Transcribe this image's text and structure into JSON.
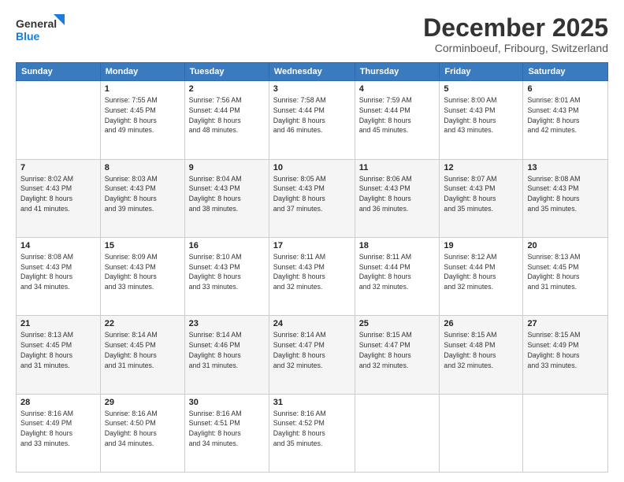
{
  "header": {
    "logo_line1": "General",
    "logo_line2": "Blue",
    "month": "December 2025",
    "location": "Corminboeuf, Fribourg, Switzerland"
  },
  "weekdays": [
    "Sunday",
    "Monday",
    "Tuesday",
    "Wednesday",
    "Thursday",
    "Friday",
    "Saturday"
  ],
  "weeks": [
    [
      {
        "day": "",
        "info": ""
      },
      {
        "day": "1",
        "info": "Sunrise: 7:55 AM\nSunset: 4:45 PM\nDaylight: 8 hours\nand 49 minutes."
      },
      {
        "day": "2",
        "info": "Sunrise: 7:56 AM\nSunset: 4:44 PM\nDaylight: 8 hours\nand 48 minutes."
      },
      {
        "day": "3",
        "info": "Sunrise: 7:58 AM\nSunset: 4:44 PM\nDaylight: 8 hours\nand 46 minutes."
      },
      {
        "day": "4",
        "info": "Sunrise: 7:59 AM\nSunset: 4:44 PM\nDaylight: 8 hours\nand 45 minutes."
      },
      {
        "day": "5",
        "info": "Sunrise: 8:00 AM\nSunset: 4:43 PM\nDaylight: 8 hours\nand 43 minutes."
      },
      {
        "day": "6",
        "info": "Sunrise: 8:01 AM\nSunset: 4:43 PM\nDaylight: 8 hours\nand 42 minutes."
      }
    ],
    [
      {
        "day": "7",
        "info": "Sunrise: 8:02 AM\nSunset: 4:43 PM\nDaylight: 8 hours\nand 41 minutes."
      },
      {
        "day": "8",
        "info": "Sunrise: 8:03 AM\nSunset: 4:43 PM\nDaylight: 8 hours\nand 39 minutes."
      },
      {
        "day": "9",
        "info": "Sunrise: 8:04 AM\nSunset: 4:43 PM\nDaylight: 8 hours\nand 38 minutes."
      },
      {
        "day": "10",
        "info": "Sunrise: 8:05 AM\nSunset: 4:43 PM\nDaylight: 8 hours\nand 37 minutes."
      },
      {
        "day": "11",
        "info": "Sunrise: 8:06 AM\nSunset: 4:43 PM\nDaylight: 8 hours\nand 36 minutes."
      },
      {
        "day": "12",
        "info": "Sunrise: 8:07 AM\nSunset: 4:43 PM\nDaylight: 8 hours\nand 35 minutes."
      },
      {
        "day": "13",
        "info": "Sunrise: 8:08 AM\nSunset: 4:43 PM\nDaylight: 8 hours\nand 35 minutes."
      }
    ],
    [
      {
        "day": "14",
        "info": "Sunrise: 8:08 AM\nSunset: 4:43 PM\nDaylight: 8 hours\nand 34 minutes."
      },
      {
        "day": "15",
        "info": "Sunrise: 8:09 AM\nSunset: 4:43 PM\nDaylight: 8 hours\nand 33 minutes."
      },
      {
        "day": "16",
        "info": "Sunrise: 8:10 AM\nSunset: 4:43 PM\nDaylight: 8 hours\nand 33 minutes."
      },
      {
        "day": "17",
        "info": "Sunrise: 8:11 AM\nSunset: 4:43 PM\nDaylight: 8 hours\nand 32 minutes."
      },
      {
        "day": "18",
        "info": "Sunrise: 8:11 AM\nSunset: 4:44 PM\nDaylight: 8 hours\nand 32 minutes."
      },
      {
        "day": "19",
        "info": "Sunrise: 8:12 AM\nSunset: 4:44 PM\nDaylight: 8 hours\nand 32 minutes."
      },
      {
        "day": "20",
        "info": "Sunrise: 8:13 AM\nSunset: 4:45 PM\nDaylight: 8 hours\nand 31 minutes."
      }
    ],
    [
      {
        "day": "21",
        "info": "Sunrise: 8:13 AM\nSunset: 4:45 PM\nDaylight: 8 hours\nand 31 minutes."
      },
      {
        "day": "22",
        "info": "Sunrise: 8:14 AM\nSunset: 4:45 PM\nDaylight: 8 hours\nand 31 minutes."
      },
      {
        "day": "23",
        "info": "Sunrise: 8:14 AM\nSunset: 4:46 PM\nDaylight: 8 hours\nand 31 minutes."
      },
      {
        "day": "24",
        "info": "Sunrise: 8:14 AM\nSunset: 4:47 PM\nDaylight: 8 hours\nand 32 minutes."
      },
      {
        "day": "25",
        "info": "Sunrise: 8:15 AM\nSunset: 4:47 PM\nDaylight: 8 hours\nand 32 minutes."
      },
      {
        "day": "26",
        "info": "Sunrise: 8:15 AM\nSunset: 4:48 PM\nDaylight: 8 hours\nand 32 minutes."
      },
      {
        "day": "27",
        "info": "Sunrise: 8:15 AM\nSunset: 4:49 PM\nDaylight: 8 hours\nand 33 minutes."
      }
    ],
    [
      {
        "day": "28",
        "info": "Sunrise: 8:16 AM\nSunset: 4:49 PM\nDaylight: 8 hours\nand 33 minutes."
      },
      {
        "day": "29",
        "info": "Sunrise: 8:16 AM\nSunset: 4:50 PM\nDaylight: 8 hours\nand 34 minutes."
      },
      {
        "day": "30",
        "info": "Sunrise: 8:16 AM\nSunset: 4:51 PM\nDaylight: 8 hours\nand 34 minutes."
      },
      {
        "day": "31",
        "info": "Sunrise: 8:16 AM\nSunset: 4:52 PM\nDaylight: 8 hours\nand 35 minutes."
      },
      {
        "day": "",
        "info": ""
      },
      {
        "day": "",
        "info": ""
      },
      {
        "day": "",
        "info": ""
      }
    ]
  ]
}
